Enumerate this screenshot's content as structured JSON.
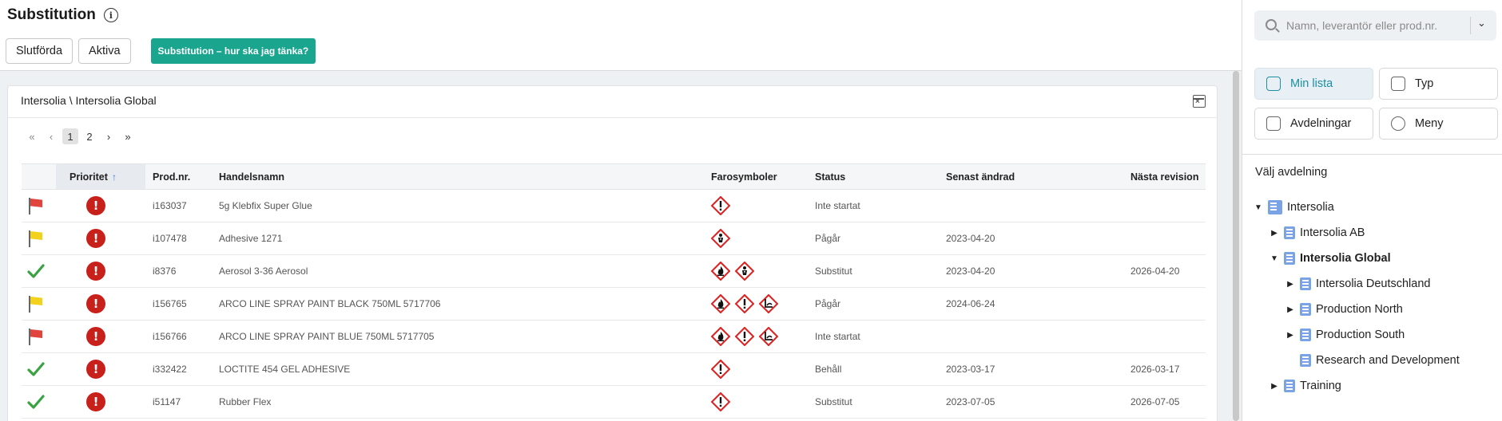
{
  "header": {
    "title": "Substitution",
    "buttons": {
      "completed": "Slutförda",
      "active": "Aktiva"
    },
    "guide_button": "Substitution – hur ska jag tänka?"
  },
  "card": {
    "breadcrumb": "Intersolia \\ Intersolia Global"
  },
  "pagination": {
    "pages": [
      "1",
      "2"
    ],
    "current": "1"
  },
  "table": {
    "columns": {
      "priority": "Prioritet",
      "prod_nr": "Prod.nr.",
      "trade_name": "Handelsnamn",
      "hazards": "Farosymboler",
      "status": "Status",
      "last_changed": "Senast ändrad",
      "next_revision": "Nästa revision"
    },
    "rows": [
      {
        "state": "red-flag",
        "prod_nr": "i163037",
        "name": "5g Klebfix Super Glue",
        "hazards": [
          "exclamation"
        ],
        "status": "Inte startat",
        "changed": "",
        "revision": ""
      },
      {
        "state": "yellow-flag",
        "prod_nr": "i107478",
        "name": "Adhesive 1271",
        "hazards": [
          "health-hazard"
        ],
        "status": "Pågår",
        "changed": "2023-04-20",
        "revision": ""
      },
      {
        "state": "check",
        "prod_nr": "i8376",
        "name": "Aerosol 3-36 Aerosol",
        "hazards": [
          "flame",
          "health-hazard"
        ],
        "status": "Substitut",
        "changed": "2023-04-20",
        "revision": "2026-04-20"
      },
      {
        "state": "yellow-flag",
        "prod_nr": "i156765",
        "name": "ARCO LINE SPRAY PAINT BLACK 750ML 5717706",
        "hazards": [
          "flame",
          "exclamation",
          "environment"
        ],
        "status": "Pågår",
        "changed": "2024-06-24",
        "revision": ""
      },
      {
        "state": "red-flag",
        "prod_nr": "i156766",
        "name": "ARCO LINE SPRAY PAINT BLUE 750ML 5717705",
        "hazards": [
          "flame",
          "exclamation",
          "environment"
        ],
        "status": "Inte startat",
        "changed": "",
        "revision": ""
      },
      {
        "state": "check",
        "prod_nr": "i332422",
        "name": "LOCTITE 454 GEL ADHESIVE",
        "hazards": [
          "exclamation"
        ],
        "status": "Behåll",
        "changed": "2023-03-17",
        "revision": "2026-03-17"
      },
      {
        "state": "check",
        "prod_nr": "i51147",
        "name": "Rubber Flex",
        "hazards": [
          "exclamation"
        ],
        "status": "Substitut",
        "changed": "2023-07-05",
        "revision": "2026-07-05"
      }
    ]
  },
  "sidebar": {
    "search_placeholder": "Namn, leverantör eller prod.nr.",
    "buttons": {
      "my_list": "Min lista",
      "type": "Typ",
      "departments": "Avdelningar",
      "menu": "Meny"
    },
    "heading": "Välj avdelning",
    "tree": [
      {
        "label": "Intersolia",
        "level": 0,
        "expanded": true,
        "bold": false,
        "root": true
      },
      {
        "label": "Intersolia AB",
        "level": 1,
        "expanded": false,
        "bold": false
      },
      {
        "label": "Intersolia Global",
        "level": 1,
        "expanded": true,
        "bold": true
      },
      {
        "label": "Intersolia Deutschland",
        "level": 2,
        "expanded": false,
        "bold": false
      },
      {
        "label": "Production North",
        "level": 2,
        "expanded": false,
        "bold": false
      },
      {
        "label": "Production South",
        "level": 2,
        "expanded": false,
        "bold": false
      },
      {
        "label": "Research and Development",
        "level": 2,
        "leaf": true,
        "bold": false
      },
      {
        "label": "Training",
        "level": 1,
        "expanded": false,
        "bold": false
      }
    ]
  },
  "colors": {
    "accent_teal": "#1aa58f",
    "priority_red": "#c8201b",
    "flag_red": "#e0443c",
    "flag_yellow": "#f2d21f",
    "check_green": "#3aa341",
    "hazard_red": "#e01f1f",
    "active_blue": "#1c8fa3"
  }
}
